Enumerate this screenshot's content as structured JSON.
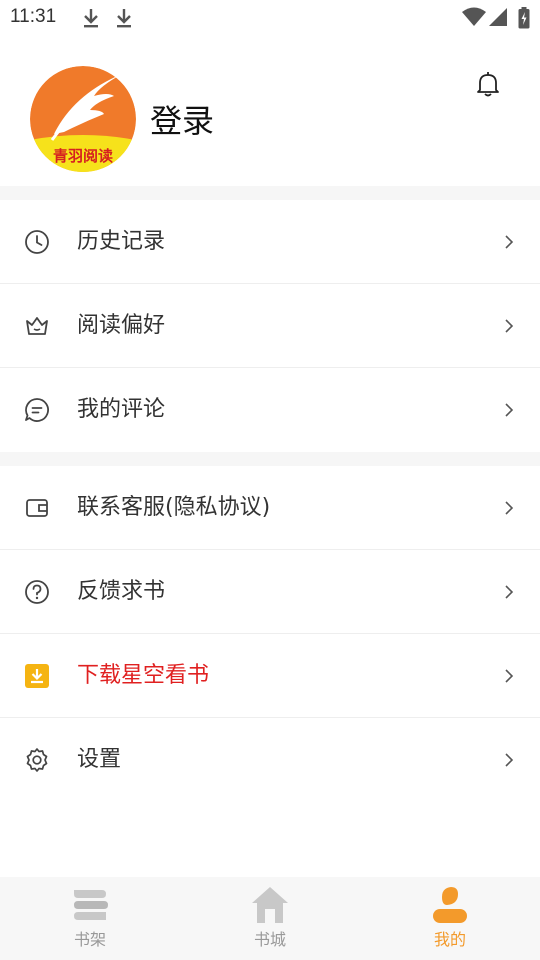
{
  "status_bar": {
    "time": "11:31"
  },
  "header": {
    "avatar_text": "青羽阅读",
    "login_label": "登录"
  },
  "menu": {
    "group1": [
      {
        "label": "历史记录",
        "icon": "clock-icon"
      },
      {
        "label": "阅读偏好",
        "icon": "crown-icon"
      },
      {
        "label": "我的评论",
        "icon": "comment-icon"
      }
    ],
    "group2": [
      {
        "label": "联系客服(隐私协议)",
        "icon": "wallet-icon"
      },
      {
        "label": "反馈求书",
        "icon": "question-icon"
      },
      {
        "label": "下载星空看书",
        "icon": "download-icon",
        "color": "#e02020"
      },
      {
        "label": "设置",
        "icon": "gear-icon"
      }
    ]
  },
  "bottom_nav": {
    "items": [
      {
        "label": "书架",
        "icon": "bookshelf-icon",
        "active": false
      },
      {
        "label": "书城",
        "icon": "home-icon",
        "active": false
      },
      {
        "label": "我的",
        "icon": "user-icon",
        "active": true
      }
    ]
  },
  "colors": {
    "accent": "#f39a2b",
    "download_text": "#e02020",
    "avatar_bg": "#f07a2a",
    "avatar_band": "#f6e21b"
  }
}
